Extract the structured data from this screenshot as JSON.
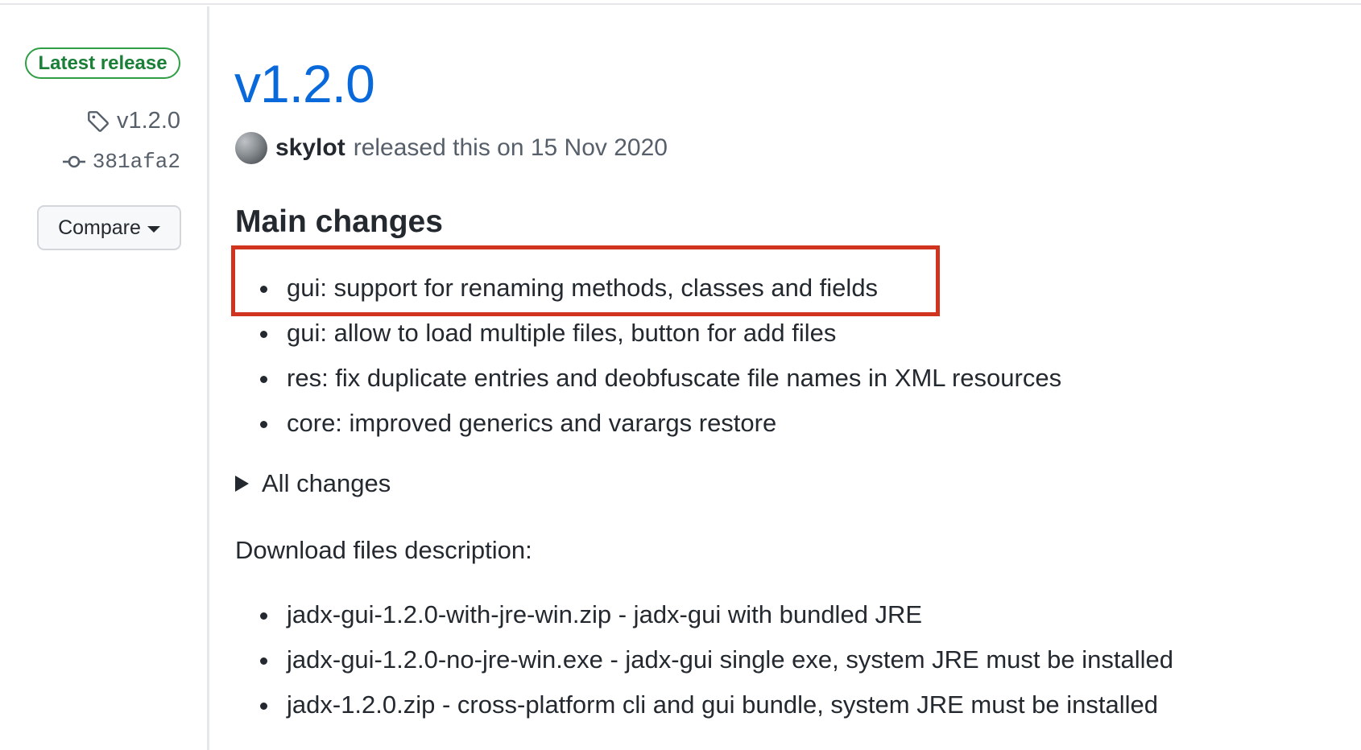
{
  "sidebar": {
    "badge": "Latest release",
    "tag": "v1.2.0",
    "commit": "381afa2",
    "compare_label": "Compare"
  },
  "release": {
    "title": "v1.2.0",
    "author": "skylot",
    "released_text": "released this on 15 Nov 2020"
  },
  "main_changes": {
    "heading": "Main changes",
    "items": [
      "gui: support for renaming methods, classes and fields",
      "gui: allow to load multiple files, button for add files",
      "res: fix duplicate entries and deobfuscate file names in XML resources",
      "core: improved generics and varargs restore"
    ]
  },
  "all_changes_label": "All changes",
  "download": {
    "heading": "Download files description:",
    "items": [
      "jadx-gui-1.2.0-with-jre-win.zip - jadx-gui with bundled JRE",
      "jadx-gui-1.2.0-no-jre-win.exe - jadx-gui single exe, system JRE must be installed",
      "jadx-1.2.0.zip - cross-platform cli and gui bundle, system JRE must be installed"
    ]
  },
  "colors": {
    "link_blue": "#0969da",
    "badge_green": "#1a7f37",
    "highlight_red": "#d0341f"
  },
  "icons": {
    "tag": "tag-icon",
    "commit": "git-commit-icon",
    "caret": "caret-down-icon",
    "disclosure": "triangle-right-icon"
  }
}
